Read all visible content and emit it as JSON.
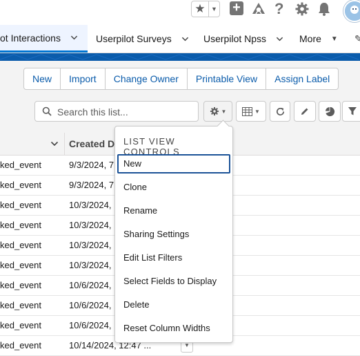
{
  "header": {
    "favorites_icon": "star-icon",
    "favorites_menu_icon": "chevron-down-icon",
    "icons": [
      "plus-icon",
      "trailhead-icon",
      "help-icon",
      "gear-icon",
      "bell-icon",
      "avatar"
    ]
  },
  "nav": {
    "tabs": [
      {
        "label": "ot Interactions",
        "active": true
      },
      {
        "label": "Userpilot Surveys",
        "active": false
      },
      {
        "label": "Userpilot Npss",
        "active": false
      },
      {
        "label": "More",
        "active": false
      }
    ],
    "accent": "#0176d3"
  },
  "actions": {
    "buttons": [
      "New",
      "Import",
      "Change Owner",
      "Printable View",
      "Assign Label"
    ]
  },
  "search": {
    "placeholder": "Search this list...",
    "value": ""
  },
  "toolbar": {
    "icons": [
      "gear-icon",
      "table-icon",
      "refresh-icon",
      "pencil-icon",
      "pie-chart-icon",
      "filter-icon"
    ]
  },
  "table": {
    "header_col2": "Created Da",
    "rows": [
      {
        "event": "ked_event",
        "created": "9/3/2024, 7"
      },
      {
        "event": "ked_event",
        "created": "9/3/2024, 7"
      },
      {
        "event": "ked_event",
        "created": "10/3/2024,"
      },
      {
        "event": "ked_event",
        "created": "10/3/2024,"
      },
      {
        "event": "ked_event",
        "created": "10/3/2024,"
      },
      {
        "event": "ked_event",
        "created": "10/3/2024,"
      },
      {
        "event": "ked_event",
        "created": "10/6/2024,"
      },
      {
        "event": "ked_event",
        "created": "10/6/2024,"
      },
      {
        "event": "ked_event",
        "created": "10/6/2024,"
      },
      {
        "event": "ked_event",
        "created": "10/14/2024, 12:47 ..."
      }
    ]
  },
  "list_view_controls": {
    "title": "LIST VIEW CONTROLS",
    "items": [
      "New",
      "Clone",
      "Rename",
      "Sharing Settings",
      "Edit List Filters",
      "Select Fields to Display",
      "Delete",
      "Reset Column Widths"
    ],
    "focused_index": 0
  },
  "colors": {
    "brand_blue": "#0b5cab",
    "link_blue": "#0b5cab",
    "focus_outline": "#1b5297"
  }
}
